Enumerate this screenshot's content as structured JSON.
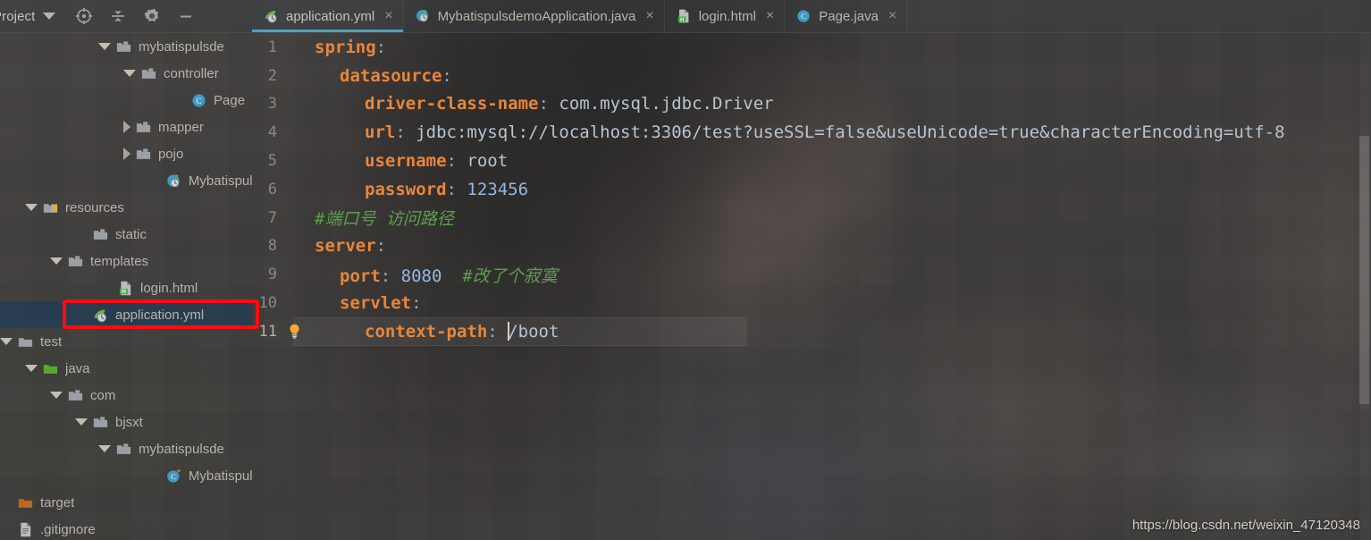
{
  "toolbar": {
    "project_label": "Project",
    "caret_icon": "chevron-down-icon",
    "icons": [
      {
        "name": "locate-target-icon",
        "title": "Select Opened File"
      },
      {
        "name": "collapse-all-icon",
        "title": "Collapse All"
      },
      {
        "name": "gear-icon",
        "title": "Settings"
      },
      {
        "name": "minimize-icon",
        "title": "Hide"
      }
    ]
  },
  "tabs": [
    {
      "label": "application.yml",
      "icon": "yaml-spring-file-icon",
      "active": true,
      "close_label": "×"
    },
    {
      "label": "MybatispulsdemoApplication.java",
      "icon": "spring-boot-class-icon",
      "active": false,
      "close_label": "×"
    },
    {
      "label": "login.html",
      "icon": "html-file-icon",
      "active": false,
      "close_label": "×"
    },
    {
      "label": "Page.java",
      "icon": "java-class-icon",
      "active": false,
      "close_label": "×"
    }
  ],
  "sidebar": {
    "items": [
      {
        "label": "mybatispulsde",
        "icon": "package-folder-icon",
        "toggle": "expanded",
        "indent": 110,
        "selected": false
      },
      {
        "label": "controller",
        "icon": "package-folder-icon",
        "toggle": "expanded",
        "indent": 138,
        "selected": false
      },
      {
        "label": "Page",
        "icon": "java-class-icon",
        "toggle": "none",
        "indent": 194,
        "selected": false
      },
      {
        "label": "mapper",
        "icon": "package-folder-icon",
        "toggle": "collapsed",
        "indent": 138,
        "selected": false
      },
      {
        "label": "pojo",
        "icon": "package-folder-icon",
        "toggle": "collapsed",
        "indent": 138,
        "selected": false
      },
      {
        "label": "Mybatispul",
        "icon": "spring-boot-class-icon",
        "toggle": "none",
        "indent": 166,
        "selected": false
      },
      {
        "label": "resources",
        "icon": "resources-folder-icon",
        "toggle": "expanded",
        "indent": 28,
        "selected": false
      },
      {
        "label": "static",
        "icon": "package-folder-icon",
        "toggle": "none",
        "indent": 84,
        "selected": false
      },
      {
        "label": "templates",
        "icon": "package-folder-icon",
        "toggle": "expanded",
        "indent": 56,
        "selected": false
      },
      {
        "label": "login.html",
        "icon": "html-file-icon",
        "toggle": "none",
        "indent": 112,
        "selected": false
      },
      {
        "label": "application.yml",
        "icon": "yaml-spring-file-icon",
        "toggle": "none",
        "indent": 84,
        "selected": true
      },
      {
        "label": "test",
        "icon": "plain-folder-icon",
        "toggle": "expanded",
        "indent": 0,
        "selected": false
      },
      {
        "label": "java",
        "icon": "source-folder-icon",
        "toggle": "expanded",
        "indent": 28,
        "selected": false
      },
      {
        "label": "com",
        "icon": "package-folder-icon",
        "toggle": "expanded",
        "indent": 56,
        "selected": false
      },
      {
        "label": "bjsxt",
        "icon": "package-folder-icon",
        "toggle": "expanded",
        "indent": 84,
        "selected": false
      },
      {
        "label": "mybatispulsde",
        "icon": "package-folder-icon",
        "toggle": "expanded",
        "indent": 110,
        "selected": false
      },
      {
        "label": "Mybatispul",
        "icon": "java-test-class-icon",
        "toggle": "none",
        "indent": 166,
        "selected": false
      },
      {
        "label": "target",
        "icon": "excluded-folder-icon",
        "toggle": "none",
        "indent": 0,
        "selected": false
      },
      {
        "label": ".gitignore",
        "icon": "text-file-icon",
        "toggle": "none",
        "indent": 0,
        "selected": false
      }
    ]
  },
  "editor": {
    "file": "application.yml",
    "current_line": 11,
    "gutter_icon": "intention-bulb-icon",
    "lines": [
      {
        "num": "1",
        "indent": 0,
        "key": "spring",
        "colon": ":",
        "value": "",
        "value_kind": "none",
        "comment": ""
      },
      {
        "num": "2",
        "indent": 1,
        "key": "datasource",
        "colon": ":",
        "value": "",
        "value_kind": "none",
        "comment": ""
      },
      {
        "num": "3",
        "indent": 2,
        "key": "driver-class-name",
        "colon": ":",
        "value": "com.mysql.jdbc.Driver",
        "value_kind": "plain",
        "comment": ""
      },
      {
        "num": "4",
        "indent": 2,
        "key": "url",
        "colon": ":",
        "value": "jdbc:mysql://localhost:3306/test?useSSL=false&useUnicode=true&characterEncoding=utf-8",
        "value_kind": "plain",
        "comment": ""
      },
      {
        "num": "5",
        "indent": 2,
        "key": "username",
        "colon": ":",
        "value": "root",
        "value_kind": "plain",
        "comment": ""
      },
      {
        "num": "6",
        "indent": 2,
        "key": "password",
        "colon": ":",
        "value": "123456",
        "value_kind": "numeric",
        "comment": ""
      },
      {
        "num": "7",
        "indent": 0,
        "key": "",
        "colon": "",
        "value": "",
        "value_kind": "none",
        "comment": "#端口号 访问路径"
      },
      {
        "num": "8",
        "indent": 0,
        "key": "server",
        "colon": ":",
        "value": "",
        "value_kind": "none",
        "comment": ""
      },
      {
        "num": "9",
        "indent": 1,
        "key": "port",
        "colon": ":",
        "value": "8080",
        "value_kind": "numeric",
        "comment": "#改了个寂寞"
      },
      {
        "num": "10",
        "indent": 1,
        "key": "servlet",
        "colon": ":",
        "value": "",
        "value_kind": "none",
        "comment": ""
      },
      {
        "num": "11",
        "indent": 2,
        "key": "context-path",
        "colon": ":",
        "value": "/boot",
        "value_kind": "plain",
        "comment": "",
        "caret_before_value": true
      }
    ]
  },
  "watermark": {
    "text": "https://blog.csdn.net/weixin_47120348"
  },
  "colors": {
    "accent_tab_underline": "#4f9fc4",
    "yaml_key": "#e8863c",
    "yaml_value": "#b6c4d2",
    "yaml_number": "#94b8e0",
    "comment_green": "#5d9e4e",
    "selection_blue": "#213c54",
    "annotation_red": "#fb0d10"
  }
}
